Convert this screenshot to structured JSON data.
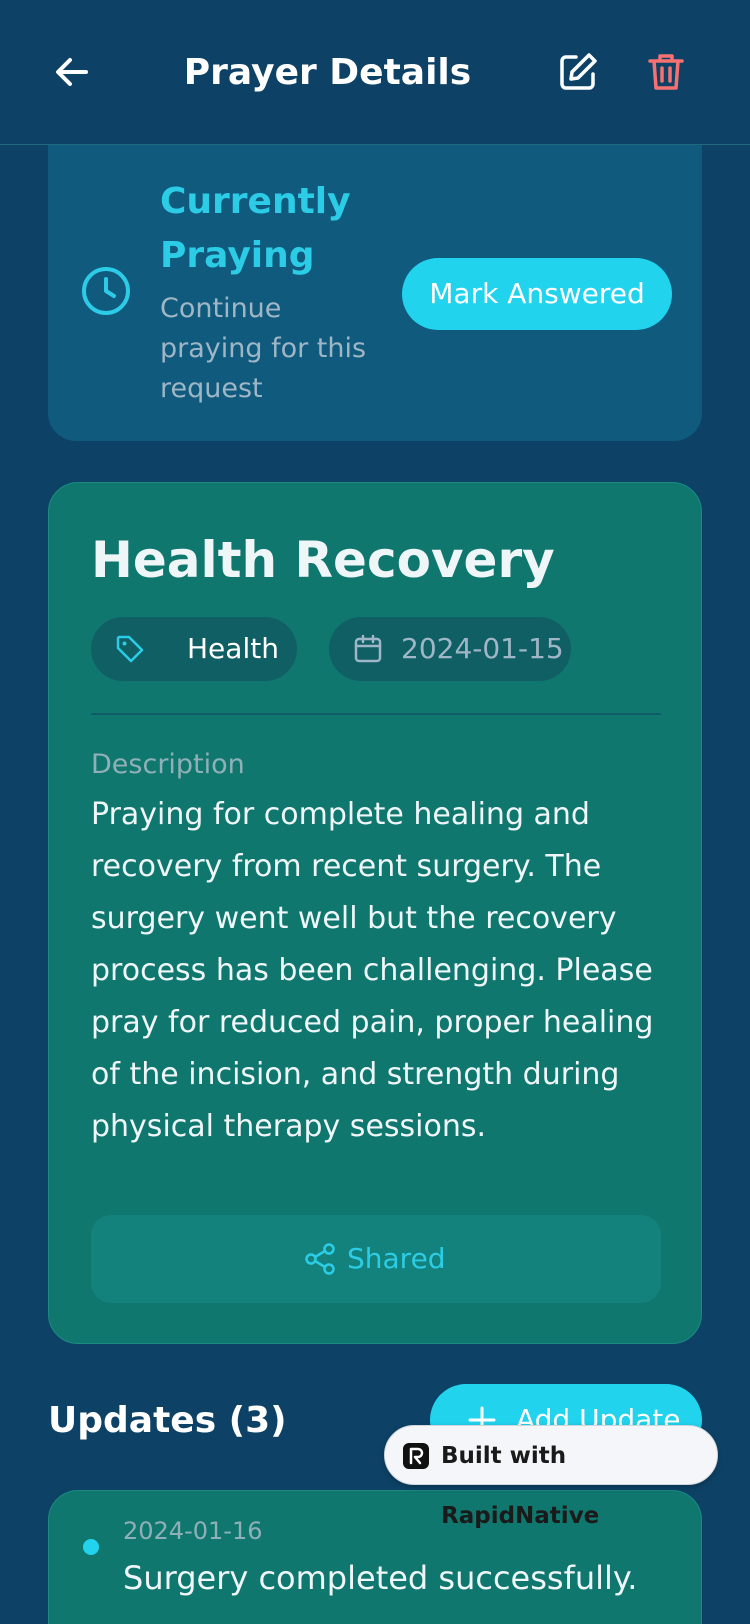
{
  "header": {
    "title": "Prayer Details",
    "back_icon": "arrow-left-icon",
    "edit_icon": "pencil-square-icon",
    "delete_icon": "trash-icon"
  },
  "status": {
    "title": "Currently Praying",
    "subtitle": "Continue praying for this request",
    "icon": "clock-icon",
    "mark_answered_label": "Mark Answered"
  },
  "prayer": {
    "title": "Health Recovery",
    "category": "Health",
    "category_icon": "tag-icon",
    "date": "2024-01-15",
    "date_icon": "calendar-icon",
    "description_label": "Description",
    "description": "Praying for complete healing and recovery from recent surgery. The surgery went well but the recovery process has been challenging. Please pray for reduced pain, proper healing of the incision, and strength during physical therapy sessions.",
    "shared_label": "Shared",
    "shared_icon": "share-icon"
  },
  "updates": {
    "title": "Updates (3)",
    "add_label": "Add Update",
    "items": [
      {
        "date": "2024-01-16",
        "text": "Surgery completed successfully."
      }
    ]
  },
  "badge": {
    "label": "Built with RapidNative"
  },
  "colors": {
    "background": "#0d4266",
    "accent": "#22d3ee",
    "card": "#10776e",
    "danger": "#f87171"
  }
}
